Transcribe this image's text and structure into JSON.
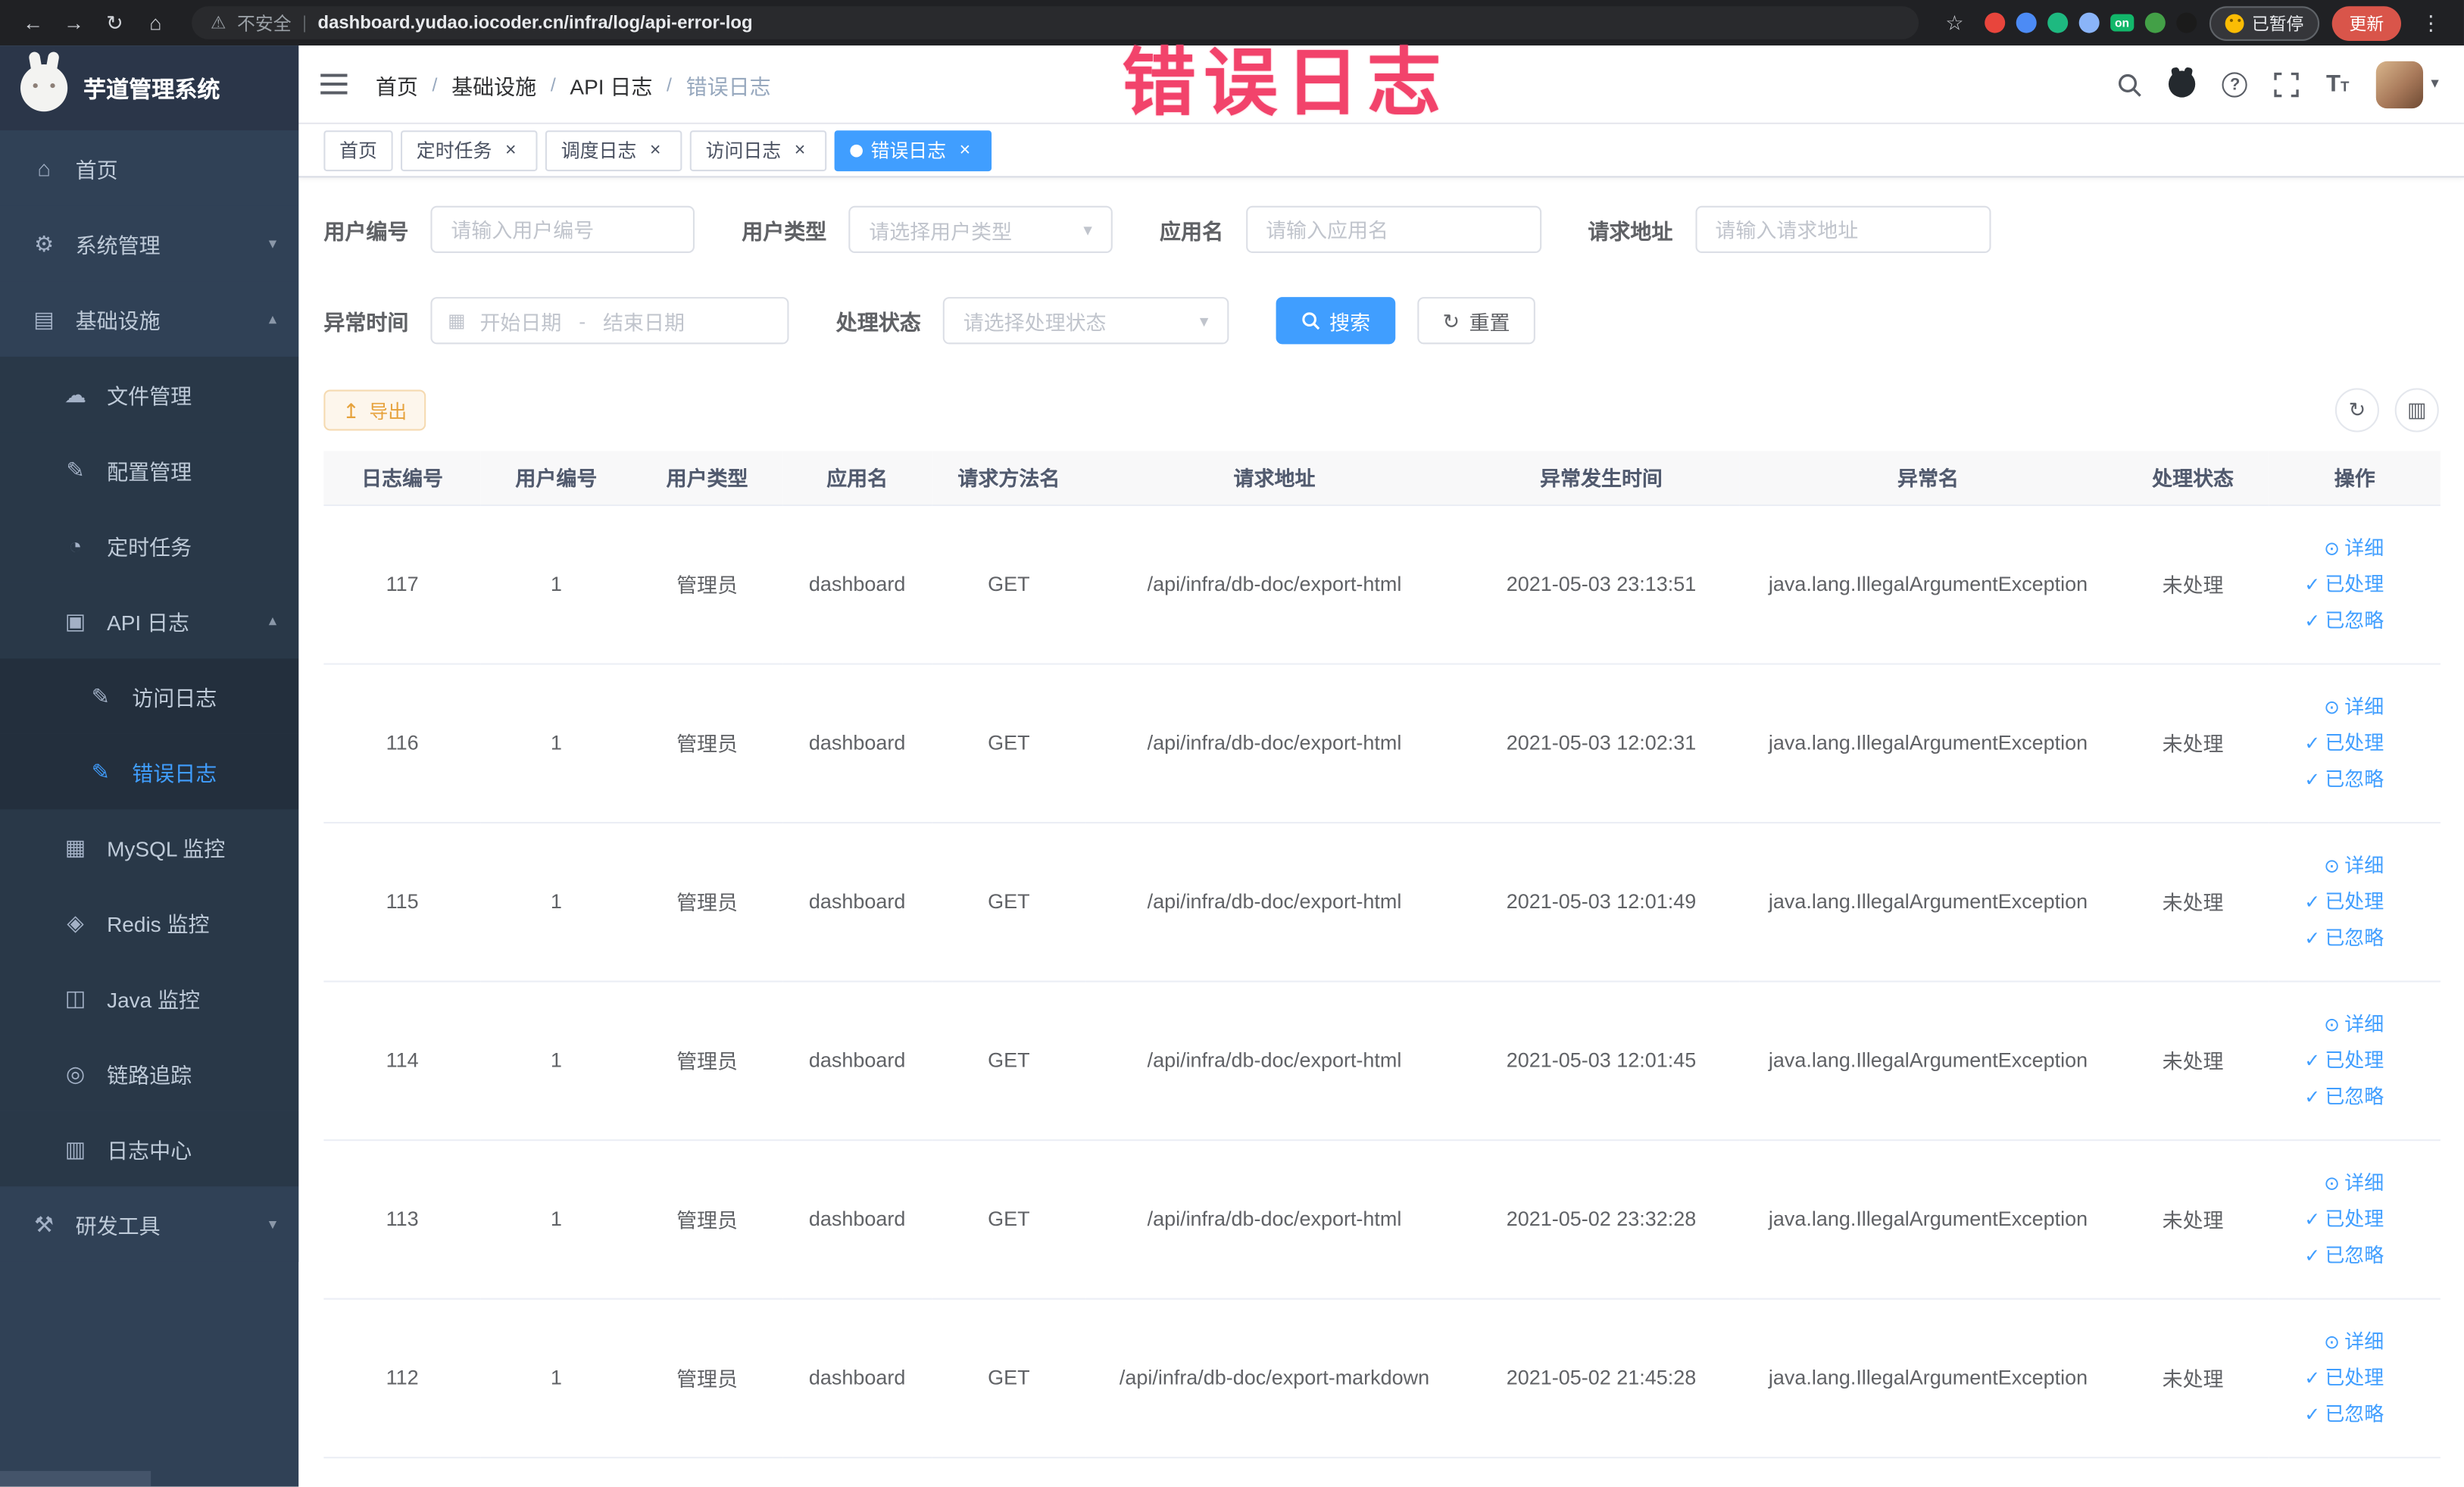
{
  "theme": {
    "primary": "#409EFF",
    "warning": "#e6a23c",
    "sidebar_bg": "#304156",
    "annotation_color": "#f2436b",
    "active_tag_bg": "#409EFF"
  },
  "browser": {
    "security_label": "不安全",
    "url": "dashboard.yudao.iocoder.cn/infra/log/api-error-log",
    "paused_badge": "已暂停",
    "update_label": "更新",
    "extensions": [
      {
        "name": "red-extension-icon",
        "color": "#e8453c"
      },
      {
        "name": "blue-extension-icon",
        "color": "#4c8bf5"
      },
      {
        "name": "green-circle-extension-icon",
        "color": "#1eb980"
      },
      {
        "name": "grid-extension-icon",
        "color": "#8ab4f8"
      },
      {
        "name": "on-badge-extension-icon",
        "color": "#12b76a",
        "text": "on"
      },
      {
        "name": "leaf-extension-icon",
        "color": "#43a047"
      },
      {
        "name": "paw-extension-icon",
        "color": "#1b1b1b"
      }
    ]
  },
  "annotation": {
    "text": "错误日志"
  },
  "sidebar": {
    "logo_title": "芋道管理系统",
    "menu": [
      {
        "key": "home",
        "label": "首页",
        "icon": "home",
        "depth": 0
      },
      {
        "key": "system-management",
        "label": "系统管理",
        "icon": "gear",
        "depth": 0,
        "arrow": "down"
      },
      {
        "key": "infrastructure",
        "label": "基础设施",
        "icon": "infra",
        "depth": 0,
        "arrow": "up"
      },
      {
        "key": "file-management",
        "label": "文件管理",
        "icon": "cloud",
        "depth": 1
      },
      {
        "key": "config-management",
        "label": "配置管理",
        "icon": "edit",
        "depth": 1
      },
      {
        "key": "scheduled-task",
        "label": "定时任务",
        "icon": "clock",
        "depth": 1
      },
      {
        "key": "api-log",
        "label": "API 日志",
        "icon": "log",
        "depth": 1,
        "arrow": "up"
      },
      {
        "key": "access-log",
        "label": "访问日志",
        "icon": "doc",
        "depth": 2
      },
      {
        "key": "error-log",
        "label": "错误日志",
        "icon": "doc",
        "depth": 2,
        "active": true
      },
      {
        "key": "mysql-monitor",
        "label": "MySQL 监控",
        "icon": "db",
        "depth": 1
      },
      {
        "key": "redis-monitor",
        "label": "Redis 监控",
        "icon": "redis",
        "depth": 1
      },
      {
        "key": "java-monitor",
        "label": "Java 监控",
        "icon": "monitor",
        "depth": 1
      },
      {
        "key": "trace",
        "label": "链路追踪",
        "icon": "trace",
        "depth": 1
      },
      {
        "key": "log-center",
        "label": "日志中心",
        "icon": "log-center",
        "depth": 1
      },
      {
        "key": "dev-tools",
        "label": "研发工具",
        "icon": "tools",
        "depth": 0,
        "arrow": "down"
      }
    ]
  },
  "icons": {
    "back": "←",
    "forward": "→",
    "reload": "↻",
    "home-btn": "⌂",
    "star": "☆",
    "kebab": "⋮",
    "warning": "⚠",
    "home": "⌂",
    "gear": "⚙",
    "infra": "▤",
    "cloud": "☁",
    "edit": "✎",
    "clock": "◔",
    "log": "▣",
    "doc": "✎",
    "db": "▦",
    "redis": "◈",
    "monitor": "◫",
    "trace": "◎",
    "log-center": "▥",
    "tools": "⚒",
    "chevron-down": "▾",
    "chevron-up": "▴",
    "calendar": "▦",
    "refresh": "↻",
    "download": "↥",
    "columns": "▥",
    "eye": "⊙",
    "check": "✓"
  },
  "header": {
    "breadcrumb": [
      "首页",
      "基础设施",
      "API 日志",
      "错误日志"
    ],
    "breadcrumb_separator": "/"
  },
  "tags": [
    {
      "key": "home",
      "label": "首页",
      "closable": false,
      "active": false
    },
    {
      "key": "scheduled-task",
      "label": "定时任务",
      "closable": true,
      "active": false
    },
    {
      "key": "schedule-log",
      "label": "调度日志",
      "closable": true,
      "active": false
    },
    {
      "key": "access-log",
      "label": "访问日志",
      "closable": true,
      "active": false
    },
    {
      "key": "error-log",
      "label": "错误日志",
      "closable": true,
      "active": true
    }
  ],
  "filters": {
    "user_id": {
      "label": "用户编号",
      "placeholder": "请输入用户编号"
    },
    "user_type": {
      "label": "用户类型",
      "placeholder": "请选择用户类型"
    },
    "app_name": {
      "label": "应用名",
      "placeholder": "请输入应用名"
    },
    "request_url": {
      "label": "请求地址",
      "placeholder": "请输入请求地址"
    },
    "exception_time": {
      "label": "异常时间",
      "start_placeholder": "开始日期",
      "separator": "-",
      "end_placeholder": "结束日期"
    },
    "process_status": {
      "label": "处理状态",
      "placeholder": "请选择处理状态"
    },
    "search_button": "搜索",
    "reset_button": "重置"
  },
  "toolbar": {
    "export_button": "导出"
  },
  "table": {
    "columns": [
      "日志编号",
      "用户编号",
      "用户类型",
      "应用名",
      "请求方法名",
      "请求地址",
      "异常发生时间",
      "异常名",
      "处理状态",
      "操作"
    ],
    "actions": [
      "详细",
      "已处理",
      "已忽略"
    ],
    "rows": [
      {
        "id": "117",
        "user_id": "1",
        "user_type": "管理员",
        "app": "dashboard",
        "method": "GET",
        "url": "/api/infra/db-doc/export-html",
        "time": "2021-05-03 23:13:51",
        "exception": "java.lang.IllegalArgumentException",
        "status": "未处理"
      },
      {
        "id": "116",
        "user_id": "1",
        "user_type": "管理员",
        "app": "dashboard",
        "method": "GET",
        "url": "/api/infra/db-doc/export-html",
        "time": "2021-05-03 12:02:31",
        "exception": "java.lang.IllegalArgumentException",
        "status": "未处理"
      },
      {
        "id": "115",
        "user_id": "1",
        "user_type": "管理员",
        "app": "dashboard",
        "method": "GET",
        "url": "/api/infra/db-doc/export-html",
        "time": "2021-05-03 12:01:49",
        "exception": "java.lang.IllegalArgumentException",
        "status": "未处理"
      },
      {
        "id": "114",
        "user_id": "1",
        "user_type": "管理员",
        "app": "dashboard",
        "method": "GET",
        "url": "/api/infra/db-doc/export-html",
        "time": "2021-05-03 12:01:45",
        "exception": "java.lang.IllegalArgumentException",
        "status": "未处理"
      },
      {
        "id": "113",
        "user_id": "1",
        "user_type": "管理员",
        "app": "dashboard",
        "method": "GET",
        "url": "/api/infra/db-doc/export-html",
        "time": "2021-05-02 23:32:28",
        "exception": "java.lang.IllegalArgumentException",
        "status": "未处理"
      },
      {
        "id": "112",
        "user_id": "1",
        "user_type": "管理员",
        "app": "dashboard",
        "method": "GET",
        "url": "/api/infra/db-doc/export-markdown",
        "time": "2021-05-02 21:45:28",
        "exception": "java.lang.IllegalArgumentException",
        "status": "未处理"
      }
    ]
  }
}
